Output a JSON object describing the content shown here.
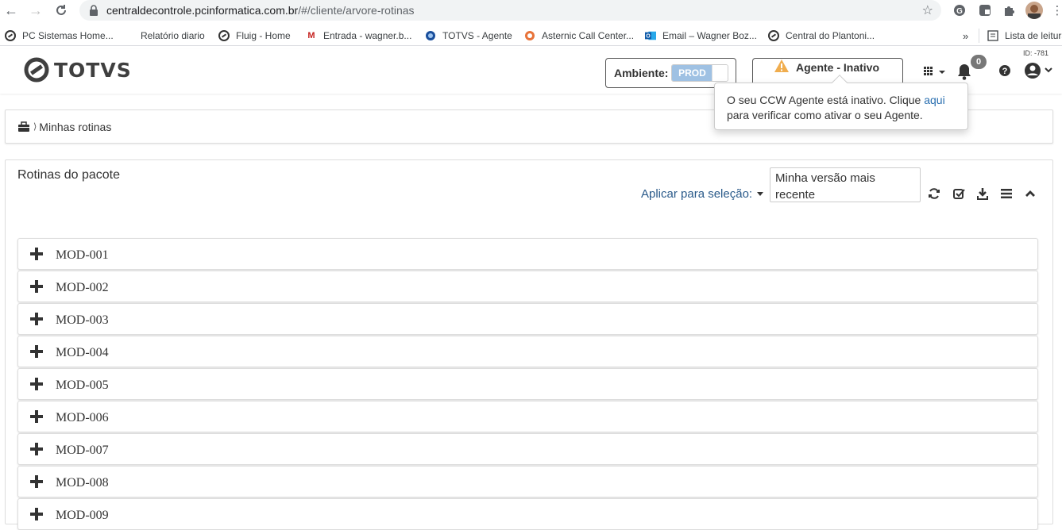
{
  "browser": {
    "url_host": "centraldecontrole.pcinformatica.com.br",
    "url_path": "/#/cliente/arvore-rotinas"
  },
  "bookmarks": [
    {
      "label": "PC Sistemas Home...",
      "icon": "totvs-icon"
    },
    {
      "label": "Relatório diario",
      "icon": "none"
    },
    {
      "label": "Fluig - Home",
      "icon": "totvs-icon"
    },
    {
      "label": "Entrada - wagner.b...",
      "icon": "gmail-icon"
    },
    {
      "label": "TOTVS - Agente",
      "icon": "globe-icon"
    },
    {
      "label": "Asternic Call Center...",
      "icon": "asternic-icon"
    },
    {
      "label": "Email – Wagner Boz...",
      "icon": "outlook-icon"
    },
    {
      "label": "Central do Plantoni...",
      "icon": "totvs-icon"
    },
    {
      "label": "Lista de leitura",
      "icon": "reading-list-icon"
    }
  ],
  "header": {
    "logo_text": "TOTVS",
    "environment_label": "Ambiente:",
    "environment_value": "PROD",
    "agent_status": "Agente - Inativo",
    "notifications_count": "0",
    "user_id": "ID: -781"
  },
  "popover": {
    "text_before": "O seu CCW Agente está inativo. Clique ",
    "link": "aqui",
    "text_after": " para verificar como ativar o seu Agente."
  },
  "breadcrumb": {
    "label": "Minhas rotinas"
  },
  "panel": {
    "title": "Rotinas do pacote",
    "apply_label": "Aplicar para seleção:",
    "version_value": "Minha versão mais recente",
    "modules": [
      "MOD-001",
      "MOD-002",
      "MOD-003",
      "MOD-004",
      "MOD-005",
      "MOD-006",
      "MOD-007",
      "MOD-008",
      "MOD-009"
    ]
  },
  "colors": {
    "link": "#2a6fb0",
    "toggle_on": "#9fc1e3",
    "warning": "#f0ad4e",
    "badge": "#777777"
  }
}
